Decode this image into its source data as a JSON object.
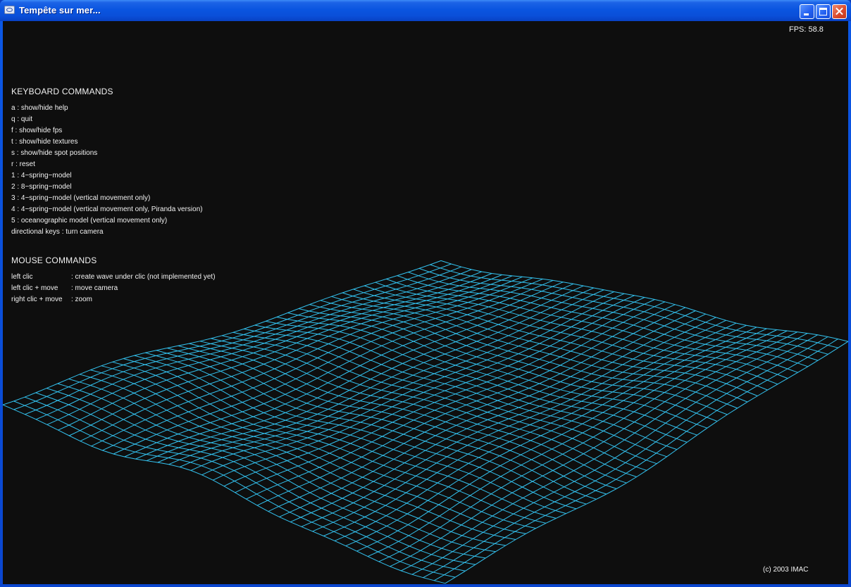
{
  "window": {
    "title": "Tempête sur mer...",
    "icon": "app-window-icon",
    "controls": [
      "minimize-icon",
      "maximize-icon",
      "close-icon"
    ]
  },
  "hud": {
    "fps": "FPS: 58.8",
    "keyboard_title": "KEYBOARD COMMANDS",
    "keyboard_commands": [
      "a : show/hide help",
      "q : quit",
      "f : show/hide fps",
      "t : show/hide textures",
      "s : show/hide spot positions",
      "r : reset",
      "1 : 4−spring−model",
      "2 : 8−spring−model",
      "3 : 4−spring−model (vertical movement only)",
      "4 : 4−spring−model (vertical movement only, Piranda version)",
      "5 : oceanographic model (vertical movement only)",
      "directional keys : turn camera"
    ],
    "mouse_title": "MOUSE COMMANDS",
    "mouse_commands": [
      {
        "key": "left clic",
        "action": ": create wave under clic (not implemented yet)"
      },
      {
        "key": "left clic + move",
        "action": ": move camera"
      },
      {
        "key": "right clic + move",
        "action": ": zoom"
      }
    ],
    "copyright": "(c) 2003 IMAC"
  },
  "scene": {
    "background": "#0e0e0e",
    "mesh_color": "#33c1ee",
    "grid_columns": 40,
    "grid_rows": 40
  }
}
